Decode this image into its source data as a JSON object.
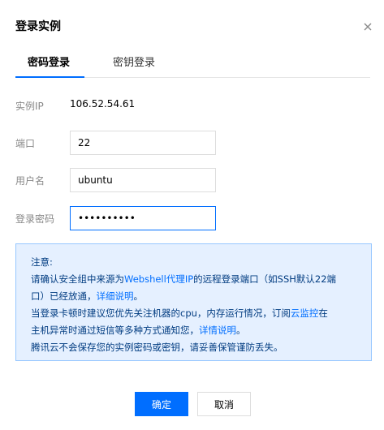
{
  "dialog": {
    "title": "登录实例"
  },
  "tabs": [
    {
      "label": "密码登录",
      "active": true
    },
    {
      "label": "密钥登录",
      "active": false
    }
  ],
  "form": {
    "ip_label": "实例IP",
    "ip_value": "106.52.54.61",
    "port_label": "端口",
    "port_value": "22",
    "user_label": "用户名",
    "user_value": "ubuntu",
    "password_label": "登录密码",
    "password_value": "••••••••••"
  },
  "notice": {
    "heading": "注意:",
    "line1_prefix": "请确认安全组中来源为",
    "line1_link": "Webshell代理IP",
    "line1_suffix": "的远程登录端口（如SSH默认22端",
    "line2_prefix": "口）已经放通，",
    "line2_link": "详细说明",
    "line2_suffix": "。",
    "line3_prefix": "当登录卡顿时建议您优先关注机器的cpu，内存运行情况，订阅",
    "line3_link": "云监控",
    "line3_suffix": "在",
    "line4_prefix": "主机异常时通过短信等多种方式通知您，",
    "line4_link": "详情说明",
    "line4_suffix": "。",
    "line5": "腾讯云不会保存您的实例密码或密钥，请妥善保管谨防丢失。"
  },
  "buttons": {
    "confirm": "确定",
    "cancel": "取消"
  },
  "colors": {
    "accent": "#006eff",
    "notice_bg": "#e5f0ff",
    "notice_border": "#97c7ff",
    "notice_text": "#003b80"
  },
  "icons": {
    "close": "close-icon"
  }
}
